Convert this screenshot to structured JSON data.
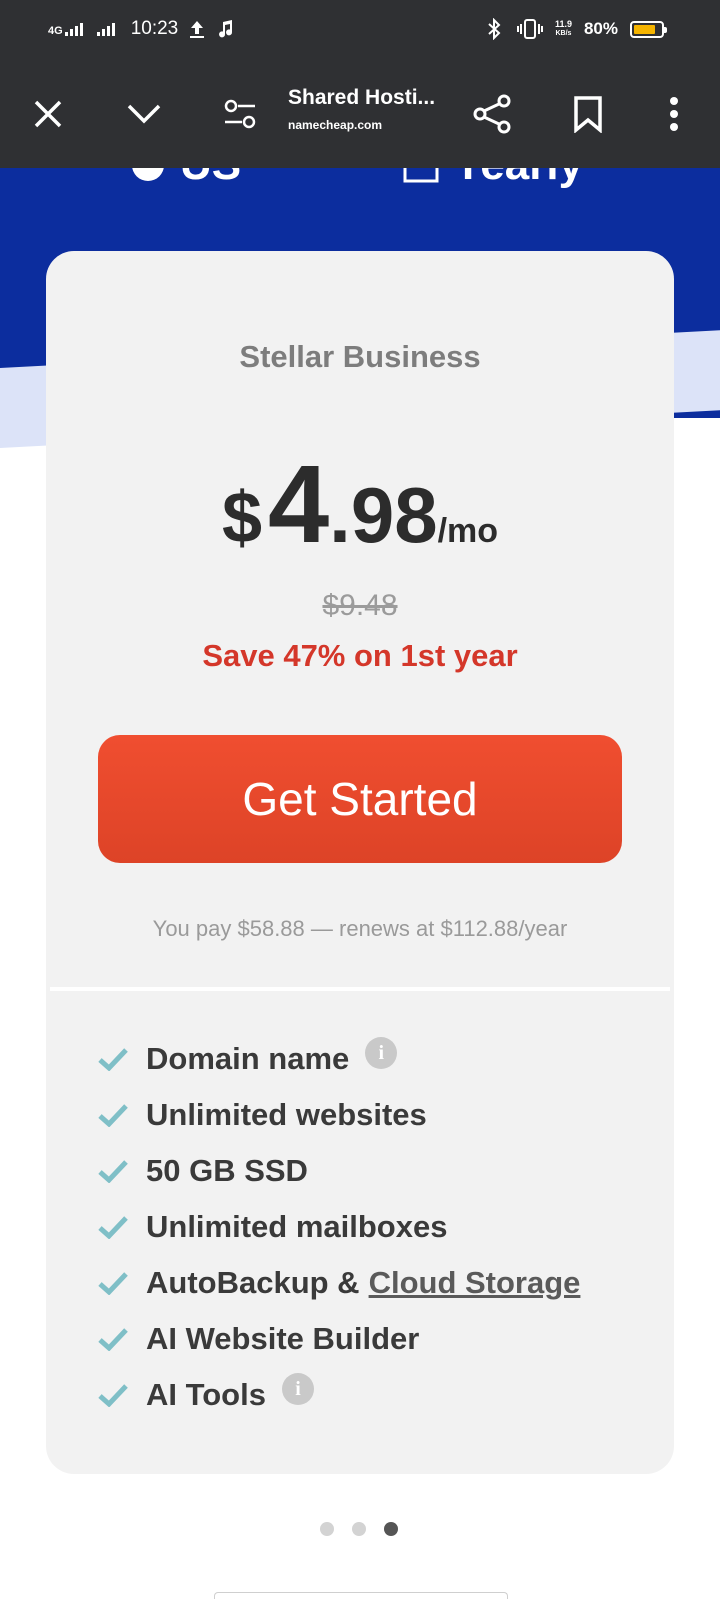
{
  "status_bar": {
    "network": "4G",
    "time": "10:23",
    "net_speed_value": "11.9",
    "net_speed_unit": "KB/s",
    "battery": "80%",
    "battery_level": 0.8
  },
  "toolbar": {
    "title": "Shared Hosti...",
    "domain": "namecheap.com"
  },
  "hero": {
    "partial_left": "US",
    "partial_right": "Yearly"
  },
  "plan": {
    "name": "Stellar Business",
    "currency": "$",
    "price_int": "4",
    "price_dec": ".98",
    "per": "/mo",
    "old_price": "$9.48",
    "save_text": "Save 47% on 1st year",
    "cta_label": "Get Started",
    "renew_text": "You pay $58.88 — renews at $112.88/year"
  },
  "features": [
    {
      "label": "Domain name",
      "info": true
    },
    {
      "label": "Unlimited websites"
    },
    {
      "label": "50 GB SSD"
    },
    {
      "label": "Unlimited mailboxes"
    },
    {
      "label": "AutoBackup &",
      "link": "Cloud Storage"
    },
    {
      "label": "AI Website Builder"
    },
    {
      "label": "AI Tools",
      "info": true
    }
  ],
  "pagination": {
    "total": 3,
    "active": 3
  },
  "colors": {
    "bar_bg": "#2f3033",
    "hero_blue": "#0c2d9e",
    "cta": "#ee4a2d",
    "save": "#d4372a",
    "check": "#7fbfc7"
  },
  "icons": {
    "close": "close-icon",
    "collapse": "chevron-down-icon",
    "settings": "page-settings-icon",
    "share": "share-icon",
    "bookmark": "bookmark-icon",
    "menu": "more-vertical-icon",
    "check": "check-icon",
    "info": "info-icon"
  }
}
